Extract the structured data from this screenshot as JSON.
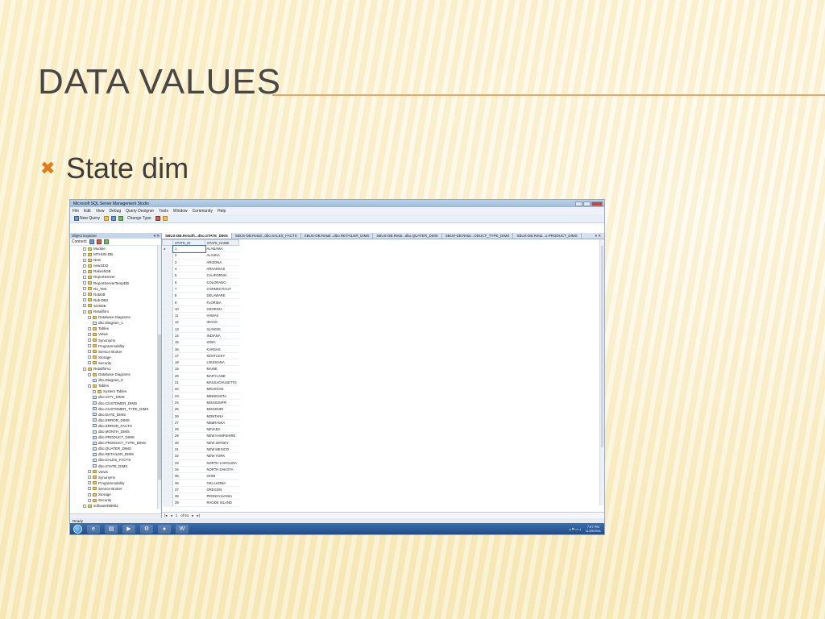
{
  "slide": {
    "title": "DATA VALUES",
    "bullet": "State dim"
  },
  "colors": {
    "accent": "#e37b17",
    "title": "#4a4644",
    "rule": "#e2a86a"
  },
  "app": {
    "title": "Microsoft SQL Server Management Studio",
    "menu": [
      "File",
      "Edit",
      "View",
      "Debug",
      "Query Designer",
      "Tools",
      "Window",
      "Community",
      "Help"
    ],
    "toolbar": {
      "new_query": "New Query",
      "change_type": "Change Type"
    }
  },
  "explorer": {
    "title": "Object Explorer",
    "connect": "Connect",
    "tree": [
      {
        "label": "Module",
        "kind": "db",
        "indent": 1
      },
      {
        "label": "MTHUN-DB",
        "kind": "db",
        "indent": 1
      },
      {
        "label": "New",
        "kind": "db",
        "indent": 1
      },
      {
        "label": "new3332",
        "kind": "db",
        "indent": 1
      },
      {
        "label": "RakeshDB",
        "kind": "db",
        "indent": 1
      },
      {
        "label": "ReportServer",
        "kind": "db",
        "indent": 1
      },
      {
        "label": "ReportServerTempDB",
        "kind": "db",
        "indent": 1
      },
      {
        "label": "Ro_Test",
        "kind": "db",
        "indent": 1
      },
      {
        "label": "RobDB",
        "kind": "db",
        "indent": 1
      },
      {
        "label": "Rob-DB2",
        "kind": "db",
        "indent": 1
      },
      {
        "label": "SUSDB",
        "kind": "db",
        "indent": 1
      },
      {
        "label": "Retailfirm",
        "kind": "db",
        "indent": 1
      },
      {
        "label": "Database Diagrams",
        "kind": "folder",
        "indent": 2
      },
      {
        "label": "dbo.Diagram_1",
        "kind": "table",
        "indent": 3
      },
      {
        "label": "Tables",
        "kind": "folder",
        "indent": 2
      },
      {
        "label": "Views",
        "kind": "folder",
        "indent": 2
      },
      {
        "label": "Synonyms",
        "kind": "folder",
        "indent": 2
      },
      {
        "label": "Programmability",
        "kind": "folder",
        "indent": 2
      },
      {
        "label": "Service Broker",
        "kind": "folder",
        "indent": 2
      },
      {
        "label": "Storage",
        "kind": "folder",
        "indent": 2
      },
      {
        "label": "Security",
        "kind": "folder",
        "indent": 2
      },
      {
        "label": "Retailfirm1",
        "kind": "db",
        "indent": 1
      },
      {
        "label": "Database Diagrams",
        "kind": "folder",
        "indent": 2
      },
      {
        "label": "dbo.Diagram_0",
        "kind": "table",
        "indent": 3
      },
      {
        "label": "Tables",
        "kind": "folder",
        "indent": 2
      },
      {
        "label": "System Tables",
        "kind": "folder",
        "indent": 3
      },
      {
        "label": "dbo.CITY_DIMS",
        "kind": "table",
        "indent": 3
      },
      {
        "label": "dbo.CUSTOMER_DIMS",
        "kind": "table",
        "indent": 3
      },
      {
        "label": "dbo.CUSTOMER_TYPE_DIMS",
        "kind": "table",
        "indent": 3
      },
      {
        "label": "dbo.DATE_DIMS",
        "kind": "table",
        "indent": 3
      },
      {
        "label": "dbo.ERROR_DIMS",
        "kind": "table",
        "indent": 3
      },
      {
        "label": "dbo.ERROR_FACTS",
        "kind": "table",
        "indent": 3
      },
      {
        "label": "dbo.MONTH_DIMS",
        "kind": "table",
        "indent": 3
      },
      {
        "label": "dbo.PRODUCT_DIMS",
        "kind": "table",
        "indent": 3
      },
      {
        "label": "dbo.PRODUCT_TYPE_DIMS",
        "kind": "table",
        "indent": 3
      },
      {
        "label": "dbo.QUATER_DIMS",
        "kind": "table",
        "indent": 3
      },
      {
        "label": "dbo.RETAILER_DIMS",
        "kind": "table",
        "indent": 3
      },
      {
        "label": "dbo.SALES_FACTS",
        "kind": "table",
        "indent": 3
      },
      {
        "label": "dbo.STATE_DIMS",
        "kind": "table",
        "indent": 3
      },
      {
        "label": "Views",
        "kind": "folder",
        "indent": 2
      },
      {
        "label": "Synonyms",
        "kind": "folder",
        "indent": 2
      },
      {
        "label": "Programmability",
        "kind": "folder",
        "indent": 2
      },
      {
        "label": "Service Broker",
        "kind": "folder",
        "indent": 2
      },
      {
        "label": "Storage",
        "kind": "folder",
        "indent": 2
      },
      {
        "label": "Security",
        "kind": "folder",
        "indent": 2
      },
      {
        "label": "softwareDB002",
        "kind": "db",
        "indent": 1
      }
    ]
  },
  "tabs": [
    {
      "label": "SBUS-DB.Retailfi...dbo.STATE_DIMS",
      "active": true
    },
    {
      "label": "SBUS-DB.Retail...dbo.SALES_FACTS",
      "active": false
    },
    {
      "label": "SBUS-DB.Retail...dbo.RETAILER_DIMS",
      "active": false
    },
    {
      "label": "SBUS-DB.Retai...dbo.QUATER_DIMS",
      "active": false
    },
    {
      "label": "SBUS-DB.Retai...ODUCT_TYPE_DIMS",
      "active": false
    },
    {
      "label": "SBUS-DB.Retai...o.PRODUCT_DIMS",
      "active": false
    }
  ],
  "grid": {
    "columns": [
      "STATE_ID",
      "STATE_NAME"
    ],
    "rows": [
      [
        "1",
        "ALABAMA"
      ],
      [
        "2",
        "ALASKA"
      ],
      [
        "3",
        "ARIZONA"
      ],
      [
        "4",
        "ARKANSAS"
      ],
      [
        "5",
        "CALIFORNIA"
      ],
      [
        "6",
        "COLORADO"
      ],
      [
        "7",
        "CONNECTICUT"
      ],
      [
        "8",
        "DELAWARE"
      ],
      [
        "9",
        "FLORIDA"
      ],
      [
        "10",
        "GEORGIA"
      ],
      [
        "11",
        "HAWAII"
      ],
      [
        "12",
        "IDAHO"
      ],
      [
        "13",
        "ILLINOIS"
      ],
      [
        "14",
        "INDIANA"
      ],
      [
        "15",
        "IOWA"
      ],
      [
        "16",
        "KANSAS"
      ],
      [
        "17",
        "KENTUCKY"
      ],
      [
        "18",
        "LOUISIANA"
      ],
      [
        "19",
        "MAINE"
      ],
      [
        "20",
        "MARYLAND"
      ],
      [
        "21",
        "MASSACHUSETTS"
      ],
      [
        "22",
        "MICHIGAN"
      ],
      [
        "23",
        "MINNESOTA"
      ],
      [
        "24",
        "MISSISSIPPI"
      ],
      [
        "25",
        "MISSOURI"
      ],
      [
        "26",
        "MONTANA"
      ],
      [
        "27",
        "NEBRASKA"
      ],
      [
        "28",
        "NEVADA"
      ],
      [
        "29",
        "NEW HAMPSHIRE"
      ],
      [
        "30",
        "NEW JERSEY"
      ],
      [
        "31",
        "NEW MEXICO"
      ],
      [
        "32",
        "NEW YORK"
      ],
      [
        "33",
        "NORTH CAROLINA"
      ],
      [
        "34",
        "NORTH DAKOTA"
      ],
      [
        "35",
        "OHIO"
      ],
      [
        "36",
        "OKLAHOMA"
      ],
      [
        "37",
        "OREGON"
      ],
      [
        "38",
        "PENNSYLVANIA"
      ],
      [
        "39",
        "RHODE ISLAND"
      ]
    ],
    "nav": {
      "current": "1",
      "of": "of 51"
    }
  },
  "status": "Ready",
  "clock": {
    "time": "7:07 PM",
    "date": "11/29/2011"
  }
}
